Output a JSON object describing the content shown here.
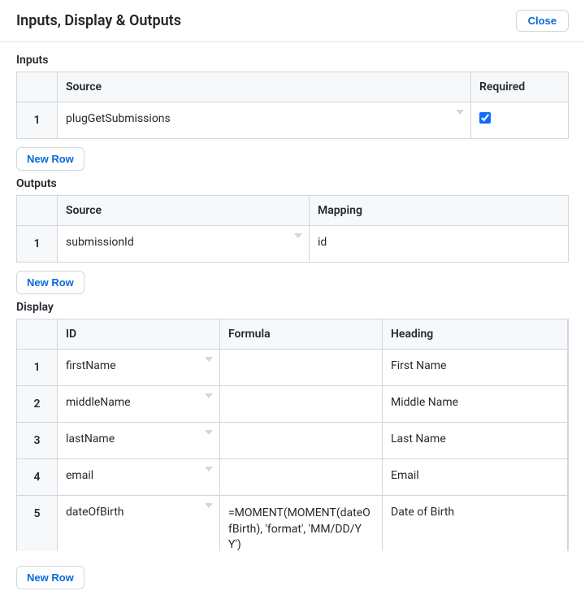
{
  "header": {
    "title": "Inputs, Display & Outputs",
    "close_label": "Close"
  },
  "inputs": {
    "section_title": "Inputs",
    "columns": {
      "source": "Source",
      "required": "Required"
    },
    "rows": [
      {
        "num": "1",
        "source": "plugGetSubmissions",
        "required": true
      }
    ],
    "new_row_label": "New Row"
  },
  "outputs": {
    "section_title": "Outputs",
    "columns": {
      "source": "Source",
      "mapping": "Mapping"
    },
    "rows": [
      {
        "num": "1",
        "source": "submissionId",
        "mapping": "id"
      }
    ],
    "new_row_label": "New Row"
  },
  "display": {
    "section_title": "Display",
    "columns": {
      "id": "ID",
      "formula": "Formula",
      "heading": "Heading"
    },
    "rows": [
      {
        "num": "1",
        "id": "firstName",
        "formula": "",
        "heading": "First Name"
      },
      {
        "num": "2",
        "id": "middleName",
        "formula": "",
        "heading": "Middle Name"
      },
      {
        "num": "3",
        "id": "lastName",
        "formula": "",
        "heading": "Last Name"
      },
      {
        "num": "4",
        "id": "email",
        "formula": "",
        "heading": "Email"
      },
      {
        "num": "5",
        "id": "dateOfBirth",
        "formula": "=MOMENT(MOMENT(dateOfBirth), 'format', 'MM/DD/YY')",
        "heading": "Date of Birth"
      }
    ],
    "new_row_label": "New Row"
  }
}
